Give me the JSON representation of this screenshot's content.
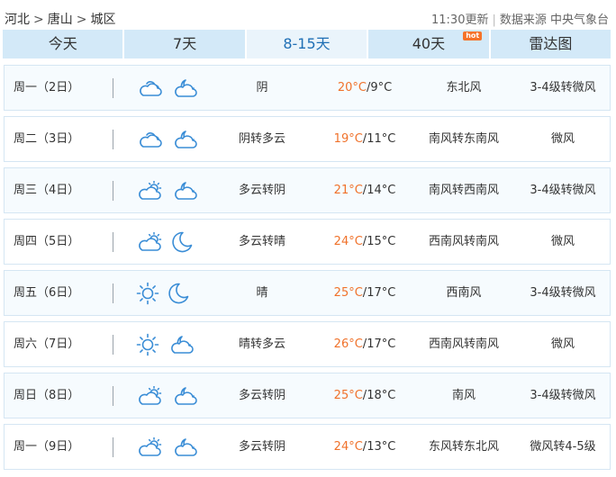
{
  "breadcrumb": {
    "items": [
      "河北",
      "唐山",
      "城区"
    ],
    "separator": ">"
  },
  "meta": {
    "update_time": "11:30更新",
    "source": "数据来源 中央气象台"
  },
  "tabs": [
    {
      "label": "今天",
      "active": false
    },
    {
      "label": "7天",
      "active": false
    },
    {
      "label": "8-15天",
      "active": true
    },
    {
      "label": "40天",
      "active": false,
      "badge": "hot"
    },
    {
      "label": "雷达图",
      "active": false
    }
  ],
  "forecast": [
    {
      "day": "周一（2日）",
      "day_icon": "cloudy-icon",
      "night_icon": "cloudy-moon-icon",
      "desc": "阴",
      "high": "20°C",
      "low": "9°C",
      "wind_dir": "东北风",
      "wind_level": "3-4级转微风"
    },
    {
      "day": "周二（3日）",
      "day_icon": "cloudy-icon",
      "night_icon": "cloudy-moon-icon",
      "desc": "阴转多云",
      "high": "19°C",
      "low": "11°C",
      "wind_dir": "南风转东南风",
      "wind_level": "微风"
    },
    {
      "day": "周三（4日）",
      "day_icon": "partly-cloudy-sun-icon",
      "night_icon": "cloudy-moon-icon",
      "desc": "多云转阴",
      "high": "21°C",
      "low": "14°C",
      "wind_dir": "南风转西南风",
      "wind_level": "3-4级转微风"
    },
    {
      "day": "周四（5日）",
      "day_icon": "partly-cloudy-sun-icon",
      "night_icon": "moon-icon",
      "desc": "多云转晴",
      "high": "24°C",
      "low": "15°C",
      "wind_dir": "西南风转南风",
      "wind_level": "微风"
    },
    {
      "day": "周五（6日）",
      "day_icon": "sun-icon",
      "night_icon": "moon-icon",
      "desc": "晴",
      "high": "25°C",
      "low": "17°C",
      "wind_dir": "西南风",
      "wind_level": "3-4级转微风"
    },
    {
      "day": "周六（7日）",
      "day_icon": "sun-icon",
      "night_icon": "cloudy-moon-icon",
      "desc": "晴转多云",
      "high": "26°C",
      "low": "17°C",
      "wind_dir": "西南风转南风",
      "wind_level": "微风"
    },
    {
      "day": "周日（8日）",
      "day_icon": "partly-cloudy-sun-icon",
      "night_icon": "cloudy-moon-icon",
      "desc": "多云转阴",
      "high": "25°C",
      "low": "18°C",
      "wind_dir": "南风",
      "wind_level": "3-4级转微风"
    },
    {
      "day": "周一（9日）",
      "day_icon": "partly-cloudy-sun-icon",
      "night_icon": "cloudy-moon-icon",
      "desc": "多云转阴",
      "high": "24°C",
      "low": "13°C",
      "wind_dir": "东风转东北风",
      "wind_level": "微风转4-5级"
    }
  ],
  "colors": {
    "tab_bg": "#d3e9f8",
    "tab_active_text": "#1f6fb5",
    "high_temp": "#f0722b",
    "icon_stroke": "#3a8dd6",
    "hot_badge": "#f5732a"
  }
}
